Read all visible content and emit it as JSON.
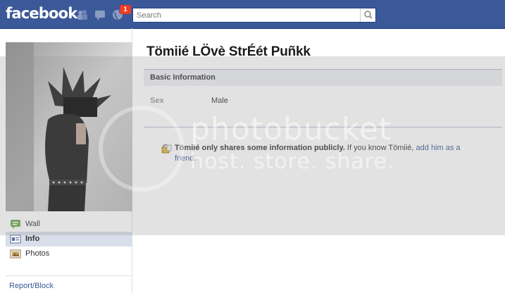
{
  "header": {
    "logo_text": "facebook",
    "notification_count": "1",
    "search_placeholder": "Search",
    "brand_color": "#3b5998"
  },
  "sidebar": {
    "items": [
      {
        "label": "Wall",
        "icon": "wall-icon",
        "active": false
      },
      {
        "label": "Info",
        "icon": "info-icon",
        "active": true
      },
      {
        "label": "Photos",
        "icon": "photos-icon",
        "active": false
      }
    ],
    "report_link": "Report/Block"
  },
  "profile": {
    "name": "Tömiié LÖvè StrÉét Puñkk",
    "section_title": "Basic Information",
    "fields": [
      {
        "label": "Sex",
        "value": "Male"
      }
    ],
    "privacy": {
      "bold_text": "Tömiié only shares some information publicly.",
      "text": " If you know Tömiié, ",
      "link": "add him as a friend",
      "end": "."
    }
  },
  "watermark": {
    "line1": "photobucket",
    "line2": "host. store. share."
  }
}
